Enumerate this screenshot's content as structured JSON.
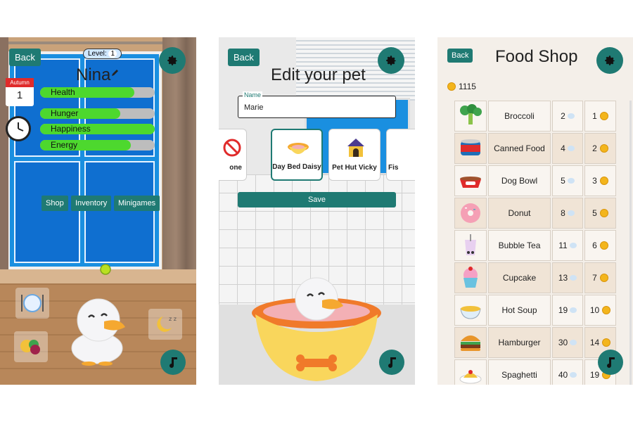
{
  "screen1": {
    "back_label": "Back",
    "level_label": "Level:",
    "level_value": "1",
    "pet_name": "Nina",
    "calendar": {
      "season": "Autumn",
      "day": "1"
    },
    "stats": [
      {
        "label": "Health",
        "value": 0.82
      },
      {
        "label": "Hunger",
        "value": 0.7
      },
      {
        "label": "Happiness",
        "value": 1.0
      },
      {
        "label": "Energy",
        "value": 0.79
      }
    ],
    "menu": {
      "shop": "Shop",
      "inventory": "Inventory",
      "minigames": "Minigames"
    },
    "colors": {
      "accent": "#1f7a73",
      "stat_fill": "#4dd82e"
    }
  },
  "screen2": {
    "back_label": "Back",
    "title": "Edit your pet",
    "name_label": "Name",
    "name_value": "Marie",
    "beds": [
      {
        "label": "None",
        "visible_label": "one"
      },
      {
        "label": "Day Bed Daisy"
      },
      {
        "label": "Pet Hut Vicky"
      },
      {
        "label": "Fis"
      }
    ],
    "save_label": "Save"
  },
  "screen3": {
    "back_label": "Back",
    "title": "Food Shop",
    "coins": "1115",
    "items": [
      {
        "name": "Broccoli",
        "restore": "2",
        "cost": "1",
        "icon": "broccoli-icon"
      },
      {
        "name": "Canned Food",
        "restore": "4",
        "cost": "2",
        "icon": "canned-food-icon"
      },
      {
        "name": "Dog Bowl",
        "restore": "5",
        "cost": "3",
        "icon": "dog-bowl-icon"
      },
      {
        "name": "Donut",
        "restore": "8",
        "cost": "5",
        "icon": "donut-icon"
      },
      {
        "name": "Bubble Tea",
        "restore": "11",
        "cost": "6",
        "icon": "bubble-tea-icon"
      },
      {
        "name": "Cupcake",
        "restore": "13",
        "cost": "7",
        "icon": "cupcake-icon"
      },
      {
        "name": "Hot Soup",
        "restore": "19",
        "cost": "10",
        "icon": "hot-soup-icon"
      },
      {
        "name": "Hamburger",
        "restore": "30",
        "cost": "14",
        "icon": "hamburger-icon"
      },
      {
        "name": "Spaghetti",
        "restore": "40",
        "cost": "19",
        "icon": "spaghetti-icon"
      }
    ]
  }
}
